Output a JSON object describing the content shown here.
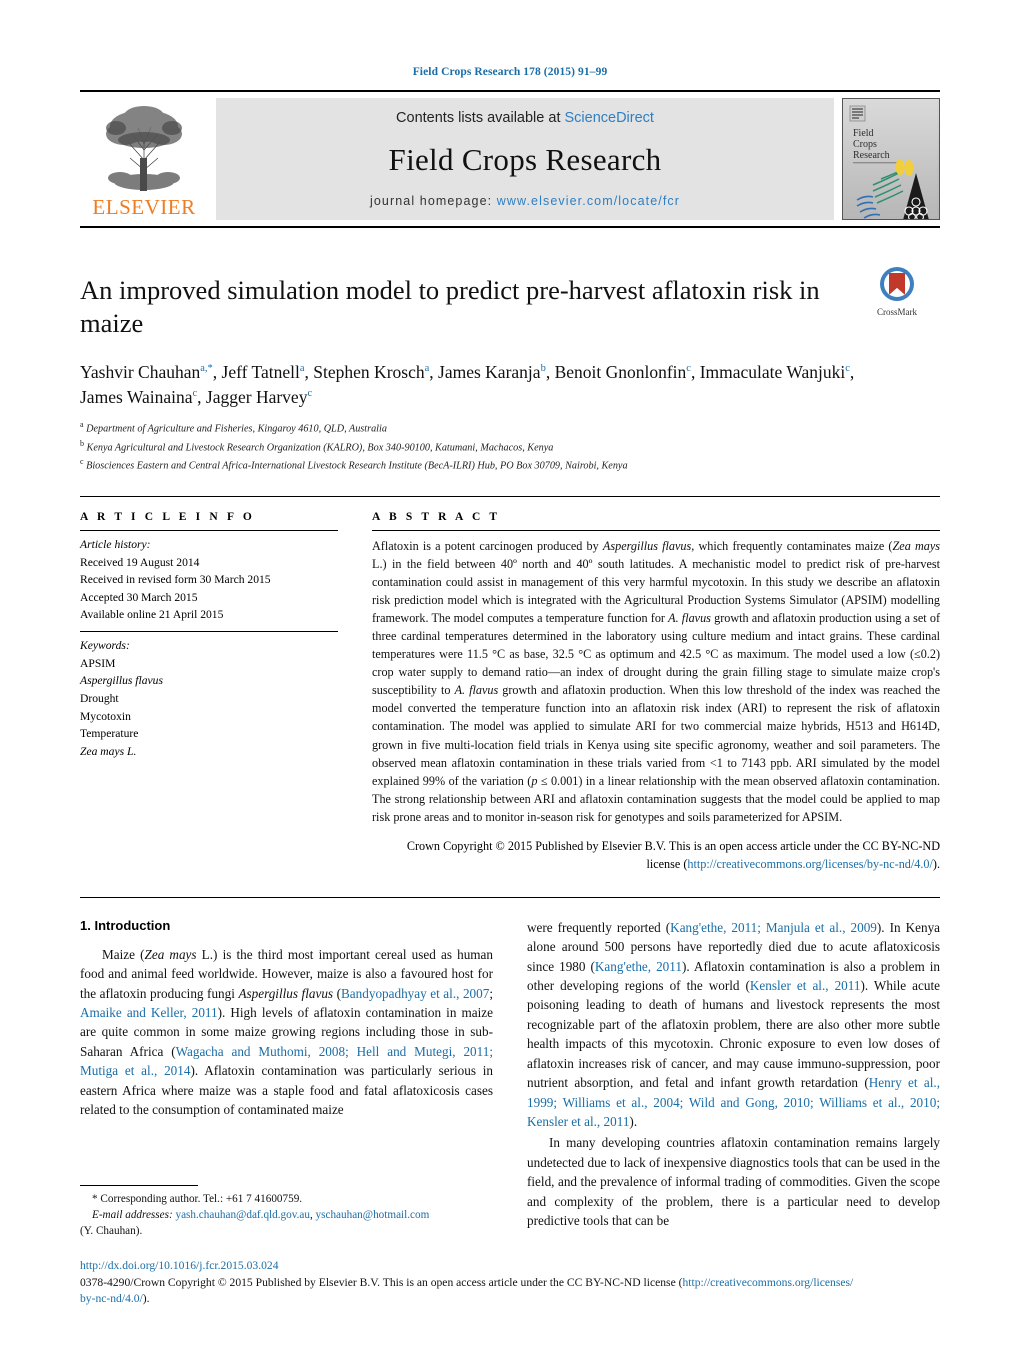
{
  "running_head": "Field Crops Research 178 (2015) 91–99",
  "masthead": {
    "contents_prefix": "Contents lists available at ",
    "sciencedirect": "ScienceDirect",
    "journal_name": "Field Crops Research",
    "homepage_prefix": "journal homepage: ",
    "homepage_url": "www.elsevier.com/locate/fcr",
    "publisher": "ELSEVIER",
    "cover": {
      "line1": "Field",
      "line2": "Crops",
      "line3": "Research"
    }
  },
  "article": {
    "title": "An improved simulation model to predict pre-harvest aflatoxin risk in maize",
    "crossmark_label": "CrossMark",
    "authors_line1": "Yashvir Chauhan",
    "authors": [
      {
        "name": "Yashvir Chauhan",
        "sup": "a,*"
      },
      {
        "name": "Jeff Tatnell",
        "sup": "a"
      },
      {
        "name": "Stephen Krosch",
        "sup": "a"
      },
      {
        "name": "James Karanja",
        "sup": "b"
      },
      {
        "name": "Benoit Gnonlonfin",
        "sup": "c"
      },
      {
        "name": "Immaculate Wanjuki",
        "sup": "c"
      },
      {
        "name": "James Wainaina",
        "sup": "c"
      },
      {
        "name": "Jagger Harvey",
        "sup": "c"
      }
    ],
    "affiliations": [
      {
        "marker": "a",
        "text": "Department of Agriculture and Fisheries, Kingaroy 4610, QLD, Australia"
      },
      {
        "marker": "b",
        "text": "Kenya Agricultural and Livestock Research Organization (KALRO), Box 340-90100, Katumani, Machacos, Kenya"
      },
      {
        "marker": "c",
        "text": "Biosciences Eastern and Central Africa-International Livestock Research Institute (BecA-ILRI) Hub, PO Box 30709, Nairobi, Kenya"
      }
    ]
  },
  "article_info": {
    "heading": "A R T I C L E  I N F O",
    "history_label": "Article history:",
    "history": [
      "Received 19 August 2014",
      "Received in revised form 30 March 2015",
      "Accepted 30 March 2015",
      "Available online 21 April 2015"
    ],
    "keywords_label": "Keywords:",
    "keywords": [
      {
        "text": "APSIM",
        "italic": false
      },
      {
        "text": "Aspergillus flavus",
        "italic": true
      },
      {
        "text": "Drought",
        "italic": false
      },
      {
        "text": "Mycotoxin",
        "italic": false
      },
      {
        "text": "Temperature",
        "italic": false
      },
      {
        "text": "Zea mays L.",
        "italic": true
      }
    ]
  },
  "abstract": {
    "heading": "A B S T R A C T",
    "p1_a": "Aflatoxin is a potent carcinogen produced by ",
    "p1_sp1": "Aspergillus flavus",
    "p1_b": ", which frequently contaminates maize (",
    "p1_sp2": "Zea mays",
    "p1_c": " L.) in the field between 40º north and 40º south latitudes. A mechanistic model to predict risk of pre-harvest contamination could assist in management of this very harmful mycotoxin. In this study we describe an aflatoxin risk prediction model which is integrated with the Agricultural Production Systems Simulator (APSIM) modelling framework. The model computes a temperature function for ",
    "p1_sp3": "A. flavus",
    "p1_d": " growth and aflatoxin production using a set of three cardinal temperatures determined in the laboratory using culture medium and intact grains. These cardinal temperatures were 11.5 °C as base, 32.5 °C as optimum and 42.5 °C as maximum. The model used a low (≤0.2) crop water supply to demand ratio—an index of drought during the grain filling stage to simulate maize crop's susceptibility to ",
    "p1_sp4": "A. flavus",
    "p1_e": " growth and aflatoxin production. When this low threshold of the index was reached the model converted the temperature function into an aflatoxin risk index (ARI) to represent the risk of aflatoxin contamination. The model was applied to simulate ARI for two commercial maize hybrids, H513 and H614D, grown in five multi-location field trials in Kenya using site specific agronomy, weather and soil parameters. The observed mean aflatoxin contamination in these trials varied from <1 to 7143 ppb. ARI simulated by the model explained 99% of the variation (",
    "p1_sp5": "p",
    "p1_f": " ≤ 0.001) in a linear relationship with the mean observed aflatoxin contamination. The strong relationship between ARI and aflatoxin contamination suggests that the model could be applied to map risk prone areas and to monitor in-season risk for genotypes and soils parameterized for APSIM.",
    "copyright_a": "Crown Copyright © 2015 Published by Elsevier B.V. This is an open access article under the CC BY-NC-ND license (",
    "copyright_link": "http://creativecommons.org/licenses/by-nc-nd/4.0/",
    "copyright_b": ")."
  },
  "introduction": {
    "number_title": "1. Introduction",
    "left": {
      "p1_a": "Maize (",
      "p1_sp1": "Zea mays",
      "p1_b": " L.) is the third most important cereal used as human food and animal feed worldwide. However, maize is also a favoured host for the aflatoxin producing fungi ",
      "p1_sp2": "Aspergillus flavus",
      "p1_c": " (",
      "p1_ref1": "Bandyopadhyay et al., 2007",
      "p1_d": "; ",
      "p1_ref2": "Amaike and Keller, 2011",
      "p1_e": "). High levels of aflatoxin contamination in maize are quite common in some maize growing regions including those in sub-Saharan Africa (",
      "p1_ref3": "Wagacha and Muthomi, 2008; Hell and Mutegi, 2011; Mutiga et al., 2014",
      "p1_f": "). Aflatoxin contamination was particularly serious in eastern Africa where maize was a staple food and fatal aflatoxicosis cases related to the consumption of contaminated maize"
    },
    "right": {
      "p1_a": "were frequently reported (",
      "p1_ref1": "Kang'ethe, 2011; Manjula et al., 2009",
      "p1_b": "). In Kenya alone around 500 persons have reportedly died due to acute aflatoxicosis since 1980 (",
      "p1_ref2": "Kang'ethe, 2011",
      "p1_c": "). Aflatoxin contamination is also a problem in other developing regions of the world (",
      "p1_ref3": "Kensler et al., 2011",
      "p1_d": "). While acute poisoning leading to death of humans and livestock represents the most recognizable part of the aflatoxin problem, there are also other more subtle health impacts of this mycotoxin. Chronic exposure to even low doses of aflatoxin increases risk of cancer, and may cause immuno-suppression, poor nutrient absorption, and fetal and infant growth retardation (",
      "p1_ref4": "Henry et al., 1999; Williams et al., 2004; Wild and Gong, 2010; Williams et al., 2010; Kensler et al., 2011",
      "p1_e": ").",
      "p2": "In many developing countries aflatoxin contamination remains largely undetected due to lack of inexpensive diagnostics tools that can be used in the field, and the prevalence of informal trading of commodities. Given the scope and complexity of the problem, there is a particular need to develop predictive tools that can be"
    }
  },
  "footnotes": {
    "corresponding": "* Corresponding author. Tel.: +61 7 41600759.",
    "email_label": "E-mail addresses:",
    "email1": "yash.chauhan@daf.qld.gov.au",
    "email_sep": ", ",
    "email2": "yschauhan@hotmail.com",
    "email_owner": "(Y. Chauhan)."
  },
  "bottom": {
    "doi": "http://dx.doi.org/10.1016/j.fcr.2015.03.024",
    "issn_copyright": "0378-4290/Crown Copyright © 2015 Published by Elsevier B.V. This is an open access article under the CC BY-NC-ND license (",
    "license_url_part1": "http://creativecommons.org/licenses/",
    "license_url_part2": "by-nc-nd/4.0/",
    "license_close": ")."
  },
  "colors": {
    "link": "#1a6ea8",
    "elsevier_orange": "#ef7c22",
    "masthead_bg": "#e3e3e3"
  }
}
